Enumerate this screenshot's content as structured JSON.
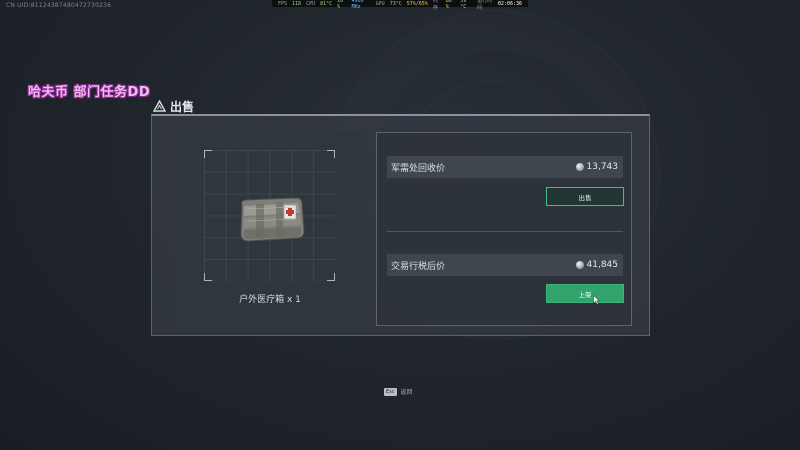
{
  "meta": {
    "uid": "CN UID:81124387480472730236"
  },
  "perf": {
    "fps_label": "FPS",
    "fps": "118",
    "cpu_label": "CPU",
    "cpu_temp": "81°C",
    "cpu_usage": "16 %",
    "cpu_freq": "4900 MHz",
    "gpu_label": "GPU",
    "gpu_temp": "73°C",
    "gpu_usage": "57%/65%",
    "mem_label": "内存",
    "mem_usage": "80 %",
    "mem_temp": "59 °C",
    "runtime_label": "运行时间",
    "runtime": "02:06:36"
  },
  "overlay_caption": "哈夫币 部门任务DD",
  "sell": {
    "title": "出售",
    "item_name": "户外医疗箱 x 1",
    "military_label": "军需处回收价",
    "military_price": "13,743",
    "sell_button": "出售",
    "market_label": "交易行税后价",
    "market_price": "41,845",
    "list_button": "上架"
  },
  "footer": {
    "esc_key": "Esc",
    "esc_label": "返回"
  },
  "colors": {
    "accent_green": "#33a36d",
    "overlay_pink": "#f3b8f5"
  },
  "icons": [
    "coin-icon",
    "warning-triangle-icon",
    "medical-case-icon",
    "cursor-icon"
  ]
}
